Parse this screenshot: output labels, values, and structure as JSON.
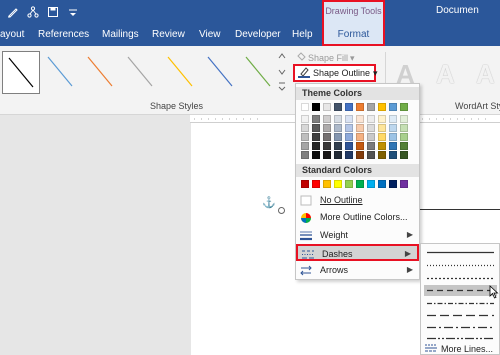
{
  "titlebar": {
    "doc_title": "Documen",
    "context_label": "Drawing Tools"
  },
  "qat": [
    "pen-icon",
    "share-tree-icon",
    "save-icon",
    "customize-qat-icon"
  ],
  "tabs": [
    {
      "label": "ayout",
      "name": "tab-layout"
    },
    {
      "label": "References",
      "name": "tab-references"
    },
    {
      "label": "Mailings",
      "name": "tab-mailings"
    },
    {
      "label": "Review",
      "name": "tab-review"
    },
    {
      "label": "View",
      "name": "tab-view"
    },
    {
      "label": "Developer",
      "name": "tab-developer"
    },
    {
      "label": "Help",
      "name": "tab-help"
    }
  ],
  "active_tab": "Format",
  "ribbon": {
    "shape_styles_label": "Shape Styles",
    "shape_fill_label": "Shape Fill",
    "shape_outline_label": "Shape Outline",
    "wordart_label": "WordArt Sty",
    "wordart_letter": "A",
    "style_line_colors": [
      "#000000",
      "#5b9bd5",
      "#ed7d31",
      "#a5a5a5",
      "#ffc000",
      "#4472c4",
      "#70ad47"
    ]
  },
  "outline_menu": {
    "theme_header": "Theme Colors",
    "theme_top": [
      "#ffffff",
      "#000000",
      "#e7e6e6",
      "#44546a",
      "#4472c4",
      "#ed7d31",
      "#a5a5a5",
      "#ffc000",
      "#5b9bd5",
      "#70ad47"
    ],
    "theme_shades": [
      [
        "#f2f2f2",
        "#7f7f7f",
        "#d0cece",
        "#d6dce4",
        "#d9e2f3",
        "#fbe5d5",
        "#ededed",
        "#fff2cc",
        "#deebf6",
        "#e2efd9"
      ],
      [
        "#d8d8d8",
        "#595959",
        "#aeabab",
        "#adb9ca",
        "#b4c6e7",
        "#f7cbac",
        "#dbdbdb",
        "#fee599",
        "#bdd7ee",
        "#c5e0b3"
      ],
      [
        "#bfbfbf",
        "#3f3f3f",
        "#757070",
        "#8496b0",
        "#8eaadb",
        "#f4b183",
        "#c9c9c9",
        "#ffd965",
        "#9cc3e5",
        "#a8d08d"
      ],
      [
        "#a5a5a5",
        "#262626",
        "#3a3838",
        "#323f4f",
        "#2f5496",
        "#c55a11",
        "#7b7b7b",
        "#bf9000",
        "#2e75b5",
        "#538135"
      ],
      [
        "#7f7f7f",
        "#0c0c0c",
        "#171616",
        "#222a35",
        "#1f3864",
        "#833c0b",
        "#525252",
        "#7f6000",
        "#1e4e79",
        "#375623"
      ]
    ],
    "standard_header": "Standard Colors",
    "standard": [
      "#c00000",
      "#ff0000",
      "#ffc000",
      "#ffff00",
      "#92d050",
      "#00b050",
      "#00b0f0",
      "#0070c0",
      "#002060",
      "#7030a0"
    ],
    "no_outline": "No Outline",
    "more_colors": "More Outline Colors...",
    "weight": "Weight",
    "dashes": "Dashes",
    "arrows": "Arrows"
  },
  "dashes_submenu": {
    "options": [
      "solid",
      "round-dot",
      "square-dot",
      "dash",
      "dash-dot",
      "long-dash",
      "long-dash-dot",
      "long-dash-dot-dot"
    ],
    "highlighted": "dash",
    "more_lines": "More Lines..."
  }
}
